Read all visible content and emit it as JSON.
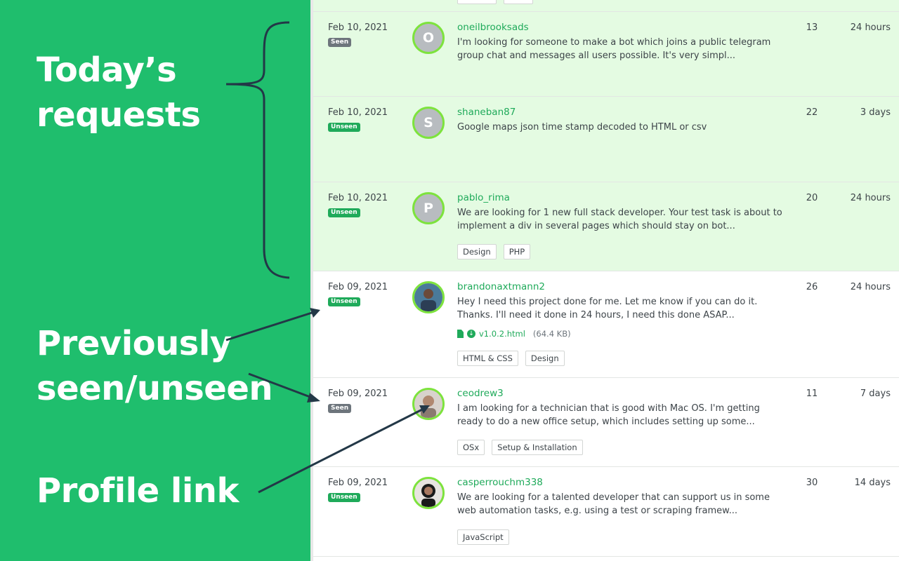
{
  "annotations": {
    "today": "Today’s requests",
    "today_line1": "Today’s",
    "today_line2": "requests",
    "prev_line1": "Previously",
    "prev_line2": "seen/unseen",
    "profile": "Profile link"
  },
  "colors": {
    "panel_bg": "#1fbe6d",
    "accent_green": "#1faa5a",
    "today_row_bg": "#e4fbe2",
    "seen_badge": "#6d757c",
    "arrow": "#233847"
  },
  "requests": [
    {
      "date": "Feb 10, 2021",
      "status": "Seen",
      "avatar_letter": "O",
      "avatar_type": "letter",
      "username": "oneilbrooksads",
      "description": "I'm looking for someone to make a bot which joins a public telegram group chat and messages all users possible. It's very simpl...",
      "count": "13",
      "age": "24 hours",
      "tags": []
    },
    {
      "date": "Feb 10, 2021",
      "status": "Unseen",
      "avatar_letter": "S",
      "avatar_type": "letter",
      "username": "shaneban87",
      "description": "Google maps json time stamp decoded to HTML or csv",
      "count": "22",
      "age": "3 days",
      "tags": []
    },
    {
      "date": "Feb 10, 2021",
      "status": "Unseen",
      "avatar_letter": "P",
      "avatar_type": "letter",
      "username": "pablo_rima",
      "description": "We are looking for 1 new full stack developer. Your test task is about to implement a div in several pages which should stay on bot...",
      "count": "20",
      "age": "24 hours",
      "tags": [
        "Design",
        "PHP"
      ]
    },
    {
      "date": "Feb 09, 2021",
      "status": "Unseen",
      "avatar_letter": "",
      "avatar_type": "photo",
      "username": "brandonaxtmann2",
      "description": "Hey I need this project done for me. Let me know if you can do it. Thanks. I'll need it done in 24 hours, I need this done ASAP...",
      "attachment": {
        "file_name": "v1.0.2.html",
        "file_size": "(64.4 KB)"
      },
      "count": "26",
      "age": "24 hours",
      "tags": [
        "HTML & CSS",
        "Design"
      ]
    },
    {
      "date": "Feb 09, 2021",
      "status": "Seen",
      "avatar_letter": "",
      "avatar_type": "photo",
      "username": "ceodrew3",
      "description": "I am looking for a technician that is good with Mac OS. I'm getting ready to do a new office setup, which includes setting up some...",
      "count": "11",
      "age": "7 days",
      "tags": [
        "OSx",
        "Setup & Installation"
      ]
    },
    {
      "date": "Feb 09, 2021",
      "status": "Unseen",
      "avatar_letter": "",
      "avatar_type": "photo",
      "username": "casperrouchm338",
      "description": "We are looking for a talented developer that can support us in some web automation tasks, e.g. using a test or scraping framew...",
      "count": "30",
      "age": "14 days",
      "tags": [
        "JavaScript"
      ]
    }
  ]
}
